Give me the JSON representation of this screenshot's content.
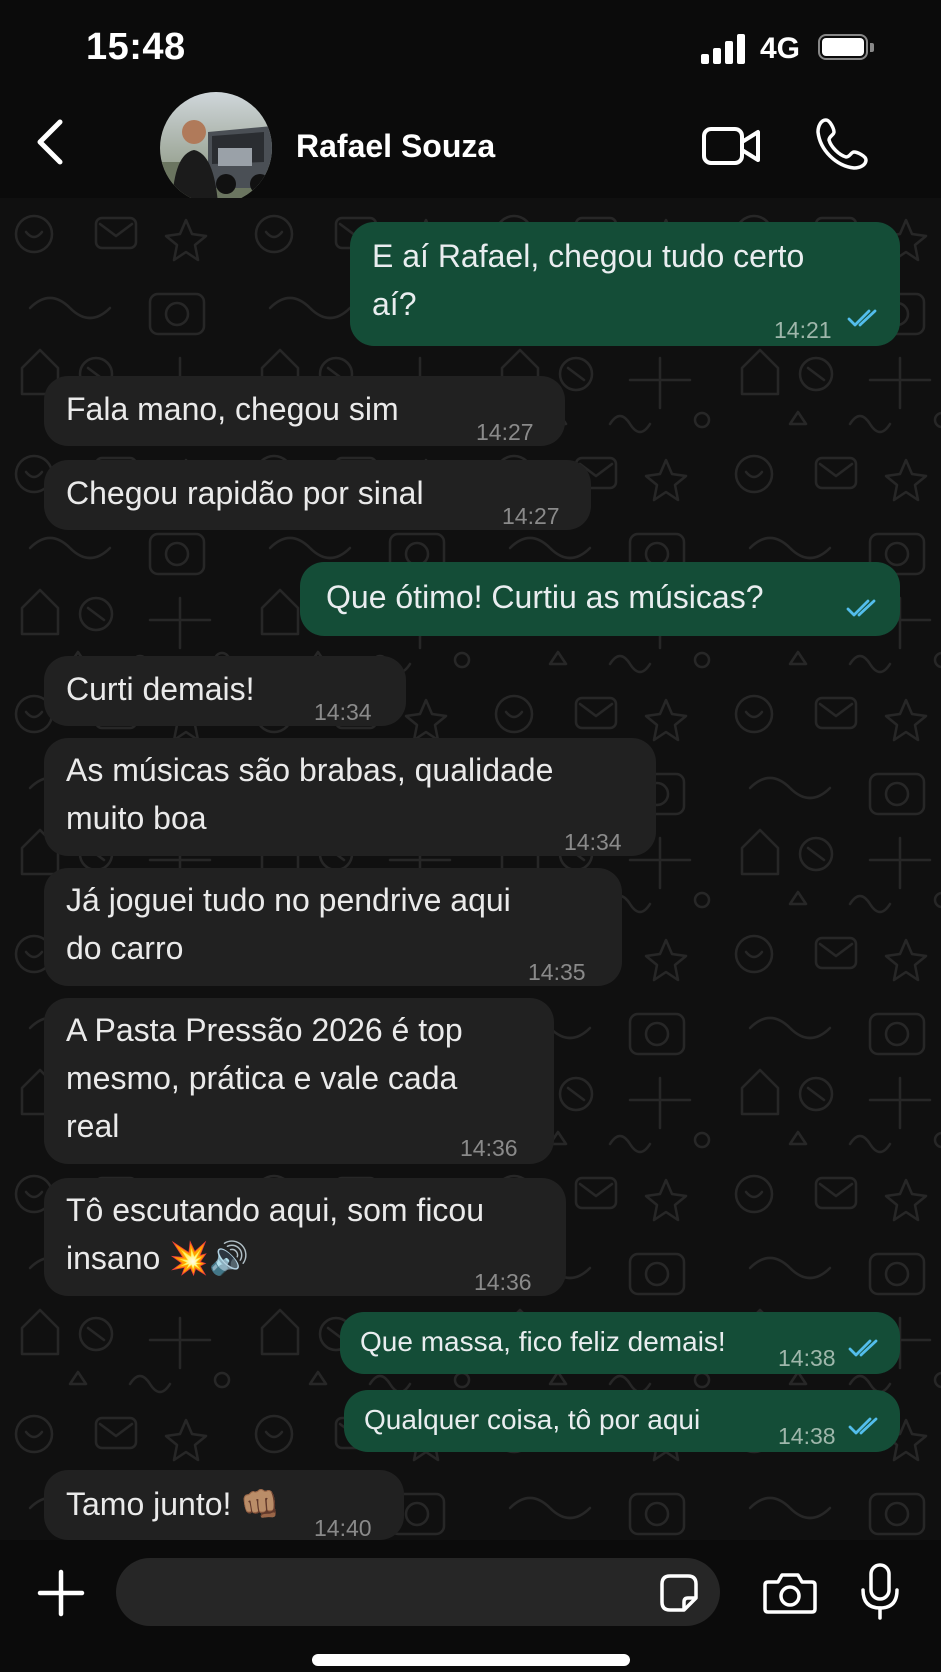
{
  "status_bar": {
    "time": "15:48",
    "network": "4G"
  },
  "header": {
    "contact_name": "Rafael Souza"
  },
  "messages": [
    {
      "dir": "out",
      "text_lines": [
        "E aí Rafael, chegou tudo certo",
        "aí?"
      ],
      "time": "14:21",
      "read": true
    },
    {
      "dir": "in",
      "text": "Fala mano, chegou sim",
      "time": "14:27"
    },
    {
      "dir": "in",
      "text": "Chegou rapidão por sinal",
      "time": "14:27"
    },
    {
      "dir": "out",
      "text": "Que ótimo! Curtiu as músicas?",
      "read": true
    },
    {
      "dir": "in",
      "text": "Curti demais!",
      "time": "14:34"
    },
    {
      "dir": "in",
      "text_lines": [
        "As músicas são brabas, qualidade",
        "muito boa"
      ],
      "time": "14:34"
    },
    {
      "dir": "in",
      "text_lines": [
        "Já joguei tudo no pendrive aqui",
        "do carro"
      ],
      "time": "14:35"
    },
    {
      "dir": "in",
      "text_lines": [
        "A Pasta Pressão 2026 é top",
        "mesmo, prática e vale cada",
        "real"
      ],
      "time": "14:36"
    },
    {
      "dir": "in",
      "text_lines": [
        "Tô escutando aqui, som ficou",
        "insano 💥🔊"
      ],
      "time": "14:36"
    },
    {
      "dir": "out",
      "text": "Que massa, fico feliz demais!",
      "time": "14:38",
      "read": true
    },
    {
      "dir": "out",
      "text": "Qualquer coisa, tô por aqui",
      "time": "14:38",
      "read": true
    },
    {
      "dir": "in",
      "text": "Tamo junto! 👊🏽",
      "time": "14:40"
    }
  ],
  "input": {
    "value": "",
    "placeholder": ""
  },
  "colors": {
    "incoming_bubble": "#212121",
    "outgoing_bubble": "#144d37",
    "read_tick": "#53bdeb",
    "background": "#0b0b0b"
  },
  "icons": {
    "back": "chevron-left-icon",
    "video": "video-camera-icon",
    "call": "phone-icon",
    "add": "plus-icon",
    "sticker": "sticker-icon",
    "camera": "camera-icon",
    "mic": "microphone-icon"
  }
}
